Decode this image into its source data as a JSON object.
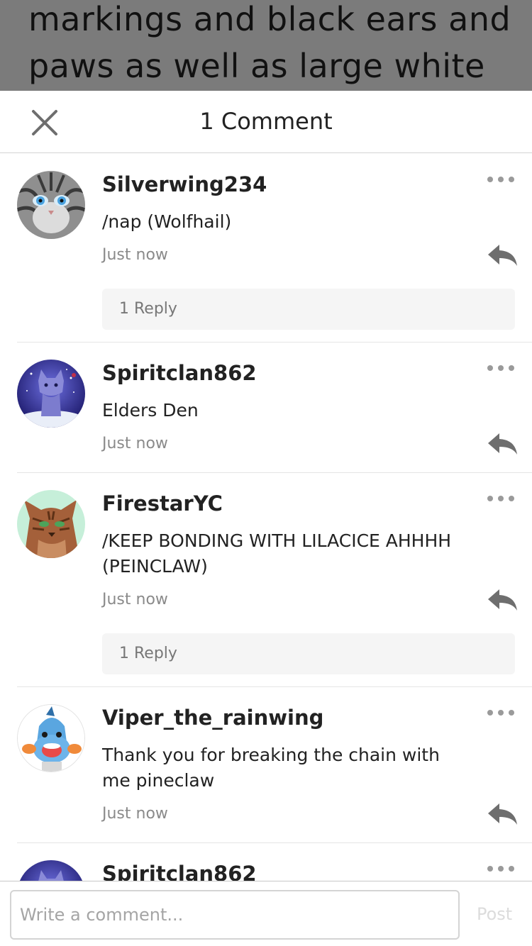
{
  "background_post": {
    "lines": [
      "markings and black ears and",
      "paws as well as large white"
    ]
  },
  "header": {
    "title": "1 Comment",
    "close_icon": "close-icon"
  },
  "comments": [
    {
      "username": "Silverwing234",
      "text": "/nap (Wolfhail)",
      "time": "Just now",
      "replies": "1 Reply",
      "avatar": "gray-tabby-kitten-avatar"
    },
    {
      "username": "Spiritclan862",
      "text": "Elders Den",
      "time": "Just now",
      "avatar": "starry-blue-cat-avatar"
    },
    {
      "username": "FirestarYC",
      "text": "/KEEP BONDING WITH LILACICE AHHHH (PEINCLAW)",
      "time": "Just now",
      "replies": "1 Reply",
      "avatar": "brown-tabby-cat-avatar"
    },
    {
      "username": "Viper_the_rainwing",
      "text": "Thank you for breaking the chain with me pineclaw",
      "time": "Just now",
      "avatar": "blue-creature-avatar"
    },
    {
      "username": "Spiritclan862",
      "avatar": "starry-blue-cat-avatar"
    }
  ],
  "footer": {
    "placeholder": "Write a comment...",
    "post_label": "Post"
  },
  "colors": {
    "overlay": "#7b7b7b",
    "muted_text": "#8a8a8a",
    "icon_gray": "#6e6e6e",
    "reply_box": "#f5f5f5",
    "post_disabled": "#dcdcdc"
  }
}
